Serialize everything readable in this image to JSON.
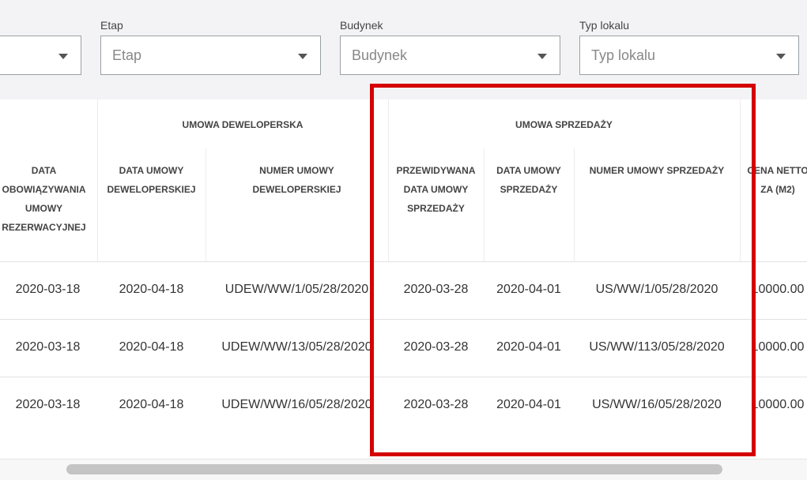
{
  "filters": {
    "first_placeholder": "",
    "etap": {
      "label": "Etap",
      "placeholder": "Etap"
    },
    "budynek": {
      "label": "Budynek",
      "placeholder": "Budynek"
    },
    "typ_lokalu": {
      "label": "Typ lokalu",
      "placeholder": "Typ lokalu"
    }
  },
  "table": {
    "group_headers": {
      "umowa_deweloperska": "UMOWA DEWELOPERSKA",
      "umowa_sprzedazy": "UMOWA SPRZEDAŻY"
    },
    "columns": {
      "data_obowiazywania": [
        "DATA",
        "OBOWIĄZYWANIA",
        "UMOWY",
        "REZERWACYJNEJ"
      ],
      "data_umowy_dew": [
        "DATA UMOWY",
        "DEWELOPERSKIEJ"
      ],
      "numer_umowy_dew": [
        "NUMER UMOWY",
        "DEWELOPERSKIEJ"
      ],
      "przewidywana": [
        "PRZEWIDYWANA",
        "DATA UMOWY",
        "SPRZEDAŻY"
      ],
      "data_umowy_sprz": [
        "DATA UMOWY",
        "SPRZEDAŻY"
      ],
      "numer_umowy_sprz": [
        "NUMER UMOWY SPRZEDAŻY"
      ],
      "cena_netto": [
        "CENA NETTO",
        "ZA (M2)"
      ]
    },
    "rows": [
      {
        "data_obow": "2020-03-18",
        "data_dew": "2020-04-18",
        "numer_dew": "UDEW/WW/1/05/28/2020",
        "przew": "2020-03-28",
        "data_sprz": "2020-04-01",
        "numer_sprz": "US/WW/1/05/28/2020",
        "cena": "10000.00"
      },
      {
        "data_obow": "2020-03-18",
        "data_dew": "2020-04-18",
        "numer_dew": "UDEW/WW/13/05/28/2020",
        "przew": "2020-03-28",
        "data_sprz": "2020-04-01",
        "numer_sprz": "US/WW/113/05/28/2020",
        "cena": "10000.00"
      },
      {
        "data_obow": "2020-03-18",
        "data_dew": "2020-04-18",
        "numer_dew": "UDEW/WW/16/05/28/2020",
        "przew": "2020-03-28",
        "data_sprz": "2020-04-01",
        "numer_sprz": "US/WW/16/05/28/2020",
        "cena": "10000.00"
      }
    ]
  },
  "colors": {
    "highlight": "#d40000"
  }
}
